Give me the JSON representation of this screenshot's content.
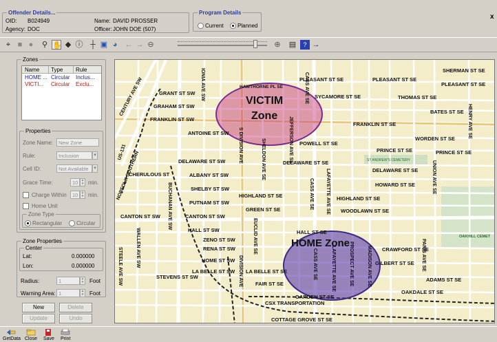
{
  "offender": {
    "title": "Offender Details...",
    "oid_label": "OID:",
    "oid_value": "B024949",
    "agency_label": "Agency:",
    "agency_value": "DOC",
    "name_label": "Name:",
    "name_value": "DAVID PROSSER",
    "officer_label": "Officer:",
    "officer_value": "JOHN DOE (507)"
  },
  "program": {
    "title": "Program Details",
    "current_label": "Current",
    "planned_label": "Planned",
    "selected": "Planned"
  },
  "window": {
    "close_label": "x"
  },
  "toolbar_icons": [
    "binoculars-icon",
    "stop-icon",
    "record-icon",
    "magnifier-icon",
    "pan-hand-icon",
    "pin-icon",
    "info-icon",
    "measure-icon",
    "layers-icon",
    "globe-icon",
    "back-arrow-icon",
    "forward-arrow-icon",
    "zoom-out-icon",
    "zoom-in-icon",
    "window-icon",
    "help-icon",
    "right-arrow-icon"
  ],
  "zones": {
    "title": "Zones",
    "columns": [
      "Name",
      "Type",
      "Rule"
    ],
    "rows": [
      {
        "name": "HOME ...",
        "type": "Circular",
        "rule": "Inclus...",
        "color": "#1a1a9c"
      },
      {
        "name": "VICTI...",
        "type": "Circular",
        "rule": "Exclu...",
        "color": "#b01818"
      }
    ]
  },
  "properties": {
    "title": "Properties",
    "zone_name_label": "Zone Name:",
    "zone_name_value": "New Zone",
    "rule_label": "Rule:",
    "rule_value": "Inclusion",
    "cell_id_label": "Cell ID:",
    "cell_id_value": "Not Available",
    "grace_label": "Grace Time:",
    "grace_value": "10",
    "grace_unit": "min.",
    "charge_label": "Charge Within",
    "charge_value": "10",
    "charge_unit": "min.",
    "home_unit_label": "Home Unit",
    "zone_type_title": "Zone Type",
    "rect_label": "Rectangular",
    "circ_label": "Circular"
  },
  "zone_props": {
    "title": "Zone Properties",
    "center_title": "Center",
    "lat_label": "Lat:",
    "lat_value": "0.000000",
    "lon_label": "Lon:",
    "lon_value": "0.000000",
    "radius_label": "Radius:",
    "radius_value": "1",
    "radius_unit": "Foot",
    "warning_label": "Warning Area:",
    "warning_value": "1",
    "warning_unit": "Foot"
  },
  "buttons": {
    "new": "New",
    "delete": "Delete",
    "update": "Update",
    "undo": "Undo"
  },
  "bottom": {
    "getdata": "GetData",
    "close": "Close",
    "save": "Save",
    "print": "Print"
  },
  "map": {
    "victim_zone_line1": "VICTIM",
    "victim_zone_line2": "Zone",
    "home_zone": "HOME Zone",
    "cemetery": "ST ANDREW'S CEMETERY",
    "oakhill": "OAKHILL CEMET",
    "streets": {
      "sherman": "SHERMAN ST SE",
      "pleasant1": "PLEASANT ST SE",
      "pleasant2": "PLEASANT ST SE",
      "pleasant3": "PLEASANT ST SE",
      "hawthorne": "HAWTHORNE PL SE",
      "sycamore": "SYCAMORE ST SE",
      "thomas": "THOMAS ST SE",
      "bates": "BATES ST SE",
      "grant": "GRANT ST SW",
      "graham": "GRAHAM ST SW",
      "franklin1": "FRANKLIN ST SW",
      "franklin2": "FRANKLIN ST SE",
      "antoine": "ANTOINE ST SW",
      "powell": "POWELL ST SE",
      "worden": "WORDEN ST SE",
      "prince1": "PRINCE ST SE",
      "prince2": "PRINCE ST SE",
      "delaware1": "DELAWARE ST SW",
      "delaware2": "DELAWARE ST SE",
      "delaware3": "DELAWARE ST SE",
      "cherulous": "CHERULOUS ST",
      "albany": "ALBANY ST SW",
      "howard": "HOWARD ST SE",
      "shelby": "SHELBY ST SW",
      "highland1": "HIGHLAND ST SE",
      "highland2": "HIGHLAND ST SE",
      "putnam": "PUTNAM ST SW",
      "green": "GREEN ST SE",
      "woodlawn": "WOODLAWN ST SE",
      "canton1": "CANTON ST SW",
      "canton2": "CANTON ST SW",
      "hall1": "HALL ST SW",
      "hall2": "HALL ST SE",
      "zeno": "ZENO ST SW",
      "rena": "RENA ST SW",
      "crawford": "CRAWFORD ST SE",
      "home_st": "HOME ST SW",
      "gilbert": "GILBERT ST SE",
      "labelle1": "LA BELLE ST SW",
      "labelle2": "LA BELLE ST SE",
      "stevens": "STEVENS ST SW",
      "fair": "FAIR ST SE",
      "adams": "ADAMS ST SE",
      "oakdale": "OAKDALE ST SE",
      "garden": "GARDEN ST SE",
      "csx": "CSX TRANSPORTATION",
      "cottage": "COTTAGE GROVE ST SE",
      "ionia": "IONIA AVE SW",
      "century": "CENTURY AVE SW",
      "i131": "US-131",
      "norfolk": "NORFOLK SOUTHERN",
      "division1": "S DIVISION AVE",
      "division2": "DIVISION AVE",
      "sheldon": "SHELDON AVE SE",
      "jefferson": "JEFFERSON AVE SE",
      "cass1": "CASS AVE SE",
      "cass2": "CASS AVE SE",
      "cass3": "CASS AVE SE",
      "lafayette1": "LAFAYETTE AVE SE",
      "lafayette2": "LAFAYETTE AVE SE",
      "prospect": "PROSPECT AVE SE",
      "madison": "MADISON AVE SE",
      "union": "UNION AVE SE",
      "henry": "HENRY AVE SE",
      "paris": "PARIS AVE SE",
      "euclid": "EUCLID AVE SE",
      "buchanan": "BUCHANAN AVE SW",
      "wallen": "WALLEN AVE SW",
      "steele": "STEELE AVE SW"
    }
  }
}
